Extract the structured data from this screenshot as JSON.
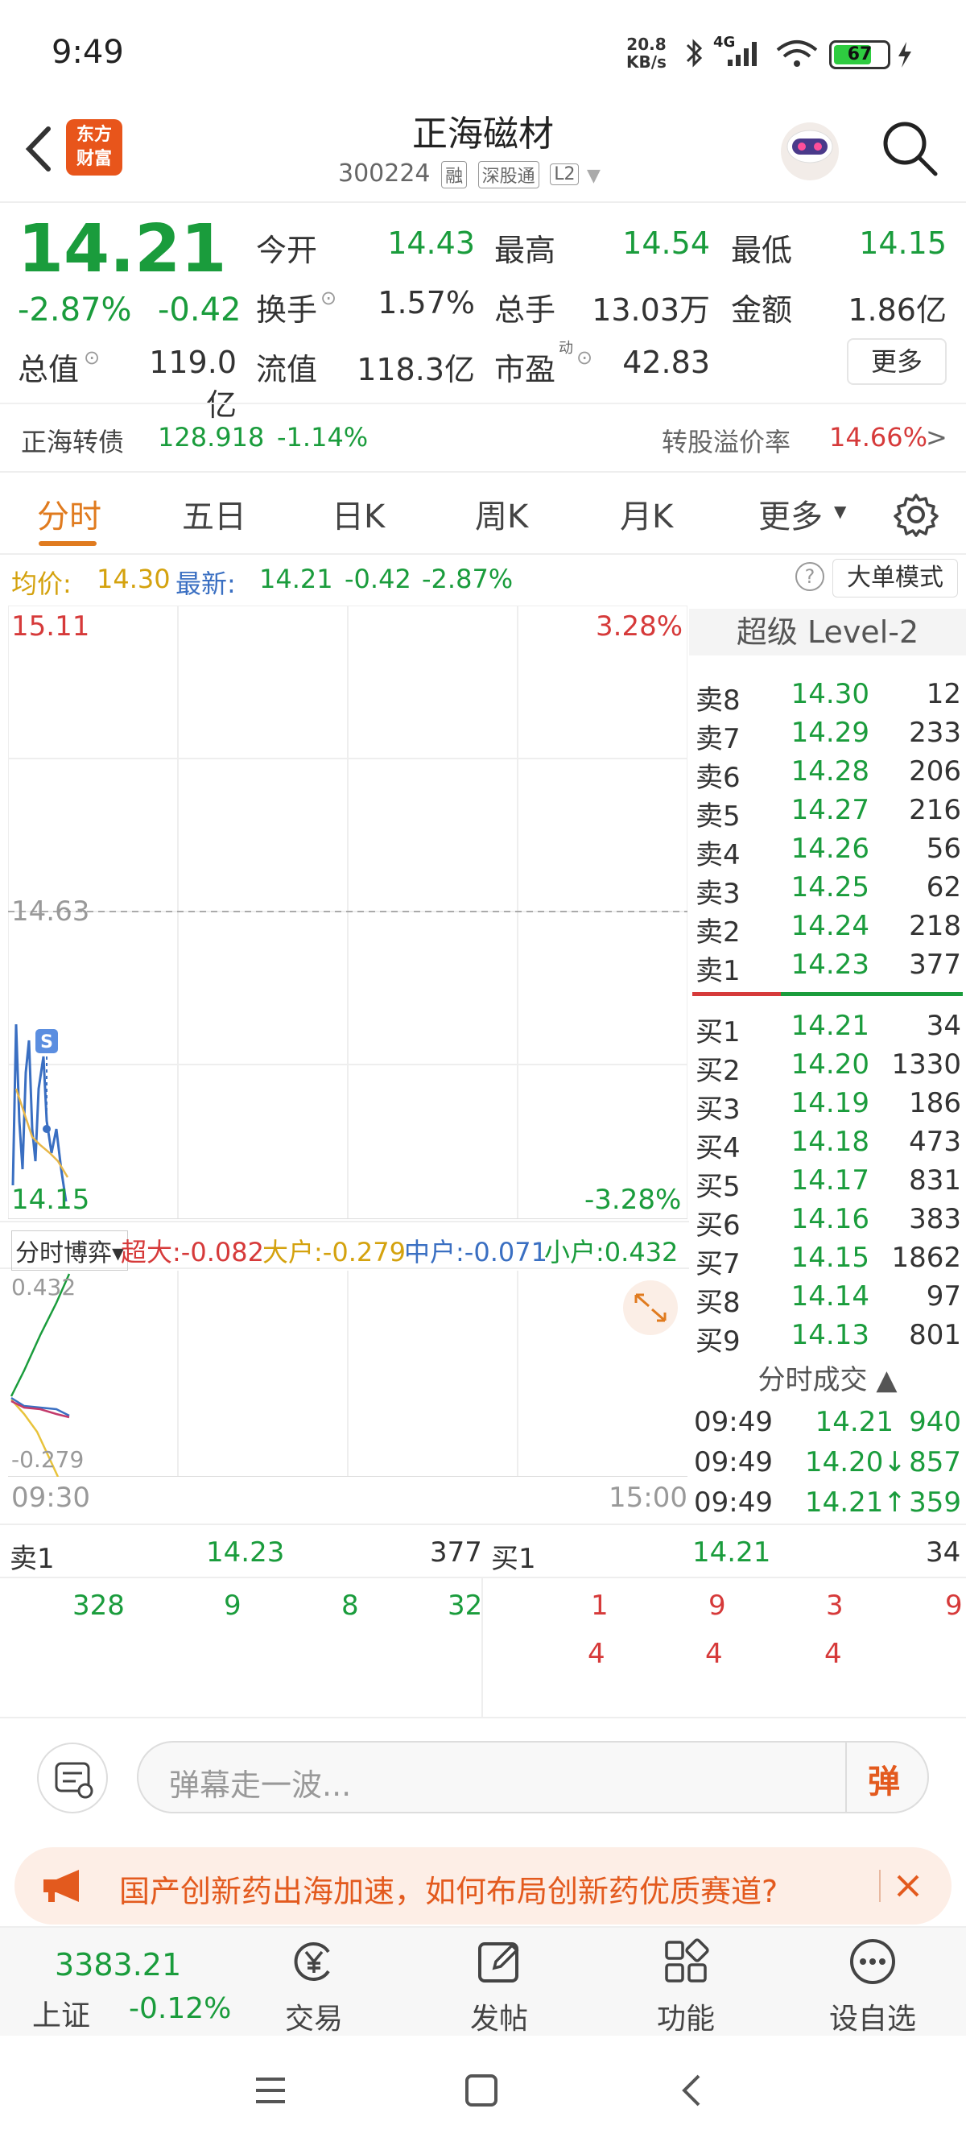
{
  "status": {
    "time": "9:49",
    "rate_top": "20.8",
    "rate_bottom": "KB/s",
    "net": "4G",
    "battery": "67"
  },
  "header": {
    "logo_line1": "东方",
    "logo_line2": "财富",
    "title": "正海磁材",
    "code": "300224",
    "tag1": "融",
    "tag2": "深股通",
    "tag3": "L2"
  },
  "quote": {
    "price": "14.21",
    "pct": "-2.87%",
    "chg": "-0.42",
    "open_label": "今开",
    "open": "14.43",
    "high_label": "最高",
    "high": "14.54",
    "low_label": "最低",
    "low": "14.15",
    "turnover_label": "换手",
    "turnover": "1.57%",
    "volume_label": "总手",
    "volume": "13.03万",
    "amount_label": "金额",
    "amount": "1.86亿",
    "mcap_label": "总值",
    "mcap": "119.0亿",
    "float_label": "流值",
    "float": "118.3亿",
    "pe_label": "市盈",
    "pe_sup": "动",
    "pe": "42.83",
    "more": "更多"
  },
  "bond": {
    "name": "正海转债",
    "price": "128.918",
    "pct": "-1.14%",
    "premium_label": "转股溢价率",
    "premium": "14.66%",
    "arrow": ">"
  },
  "tabs": [
    "分时",
    "五日",
    "日K",
    "周K",
    "月K",
    "更多"
  ],
  "avg": {
    "avg_label": "均价:",
    "avg": "14.30",
    "last_label": "最新:",
    "last": "14.21",
    "chg": "-0.42",
    "pct": "-2.87%",
    "mode": "大单模式",
    "help": "?"
  },
  "chart": {
    "top_price": "15.11",
    "top_pct": "3.28%",
    "mid_price": "14.63",
    "bot_price": "14.15",
    "bot_pct": "-3.28%",
    "marker": "S",
    "flow_label": "分时博弈",
    "super_label": "超大:",
    "super": "-0.082",
    "big_label": "大户:",
    "big": "-0.279",
    "mid_label": "中户:",
    "mid": "-0.071",
    "small_label": "小户:",
    "small": "0.432",
    "flow_top": "0.432",
    "flow_bot": "-0.279",
    "t_start": "09:30",
    "t_end": "15:00"
  },
  "level2": {
    "title": "超级 Level-2",
    "asks": [
      {
        "l": "卖8",
        "p": "14.30",
        "v": "12"
      },
      {
        "l": "卖7",
        "p": "14.29",
        "v": "233"
      },
      {
        "l": "卖6",
        "p": "14.28",
        "v": "206"
      },
      {
        "l": "卖5",
        "p": "14.27",
        "v": "216"
      },
      {
        "l": "卖4",
        "p": "14.26",
        "v": "56"
      },
      {
        "l": "卖3",
        "p": "14.25",
        "v": "62"
      },
      {
        "l": "卖2",
        "p": "14.24",
        "v": "218"
      },
      {
        "l": "卖1",
        "p": "14.23",
        "v": "377"
      }
    ],
    "bids": [
      {
        "l": "买1",
        "p": "14.21",
        "v": "34"
      },
      {
        "l": "买2",
        "p": "14.20",
        "v": "1330"
      },
      {
        "l": "买3",
        "p": "14.19",
        "v": "186"
      },
      {
        "l": "买4",
        "p": "14.18",
        "v": "473"
      },
      {
        "l": "买5",
        "p": "14.17",
        "v": "831"
      },
      {
        "l": "买6",
        "p": "14.16",
        "v": "383"
      },
      {
        "l": "买7",
        "p": "14.15",
        "v": "1862"
      },
      {
        "l": "买8",
        "p": "14.14",
        "v": "97"
      },
      {
        "l": "买9",
        "p": "14.13",
        "v": "801"
      }
    ],
    "trades_title": "分时成交",
    "trades": [
      {
        "t": "09:49",
        "p": "14.21",
        "v": "940"
      },
      {
        "t": "09:49",
        "p": "14.20↓",
        "v": "857"
      },
      {
        "t": "09:49",
        "p": "14.21↑",
        "v": "359"
      }
    ]
  },
  "queue": {
    "ask_label": "卖1",
    "ask_price": "14.23",
    "ask_vol": "377",
    "bid_label": "买1",
    "bid_price": "14.21",
    "bid_vol": "34",
    "ask_orders": [
      "328",
      "9",
      "8",
      "32"
    ],
    "bid_orders": [
      "1",
      "9",
      "3",
      "9",
      "4",
      "4",
      "4"
    ]
  },
  "comment": {
    "placeholder": "弹幕走一波...",
    "danmu": "弹"
  },
  "promo": {
    "text": "国产创新药出海加速，如何布局创新药优质赛道?"
  },
  "bottom": {
    "index_value": "3383.21",
    "index_name": "上证",
    "index_pct": "-0.12%",
    "trade": "交易",
    "post": "发帖",
    "func": "功能",
    "watch": "设自选"
  }
}
